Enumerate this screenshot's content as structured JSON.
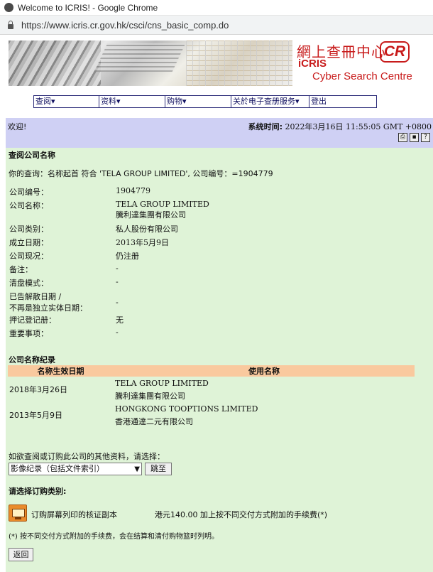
{
  "window": {
    "title": "Welcome to ICRIS! - Google Chrome",
    "url": "https://www.icris.cr.gov.hk/csci/cns_basic_comp.do"
  },
  "banner": {
    "brand_zh": "網上查冊中心",
    "brand_en": "iCRIS",
    "brand_sub": "Cyber Search Centre",
    "logo": "CR"
  },
  "nav": {
    "items": [
      "查阅▾",
      "资料▾",
      "购物▾",
      "关於电子查册服务▾",
      "登出"
    ]
  },
  "welcome": {
    "greeting": "欢迎!",
    "systime_label": "系统时间:",
    "systime_value": "2022年3月16日 11:55:05 GMT +0800",
    "tools": [
      "print-icon",
      "save-icon",
      "help-icon"
    ]
  },
  "query": {
    "heading": "查阅公司名称",
    "your_query": "你的查询：名称起首 符合 'TELA GROUP LIMITED', 公司编号：=1904779"
  },
  "company": {
    "rows": [
      {
        "label": "公司编号：",
        "value": "1904779"
      },
      {
        "label": "公司名称：",
        "value": "TELA GROUP LIMITED",
        "value2": "騰利達集團有限公司"
      },
      {
        "label": "公司类别：",
        "value": "私人股份有限公司"
      },
      {
        "label": "成立日期：",
        "value": "2013年5月9日"
      },
      {
        "label": "公司现况：",
        "value": "仍注册"
      },
      {
        "label": "备注：",
        "value": "-"
      },
      {
        "label": "清盘模式：",
        "value": "-"
      },
      {
        "label": "已告解散日期 /",
        "label2": "不再是独立实体日期：",
        "value": "-"
      },
      {
        "label": "押记登记册：",
        "value": "无"
      },
      {
        "label": "重要事项：",
        "value": "-"
      }
    ]
  },
  "name_history": {
    "heading": "公司名称纪录",
    "col_date": "名称生效日期",
    "col_name": "使用名称",
    "rows": [
      {
        "date": "2018年3月26日",
        "name_en": "TELA GROUP LIMITED",
        "name_zh": "騰利達集團有限公司"
      },
      {
        "date": "2013年5月9日",
        "name_en": "HONGKONG TOOPTIONS LIMITED",
        "name_zh": "香港通達二元有限公司"
      }
    ]
  },
  "more_info": {
    "prompt": "如欲查阅或订购此公司的其他资料，请选择：",
    "select_value": "影像纪录（包括文件索引）",
    "go_button": "跳至"
  },
  "order": {
    "heading": "请选择订购类别:",
    "item_label": "订购屏幕列印的核证副本",
    "item_price": "港元140.00 加上按不同交付方式附加的手续费(*)",
    "footnote": "(*) 按不同交付方式附加的手续费，会在结算和清付购物篮时列明。",
    "back_button": "返回"
  }
}
